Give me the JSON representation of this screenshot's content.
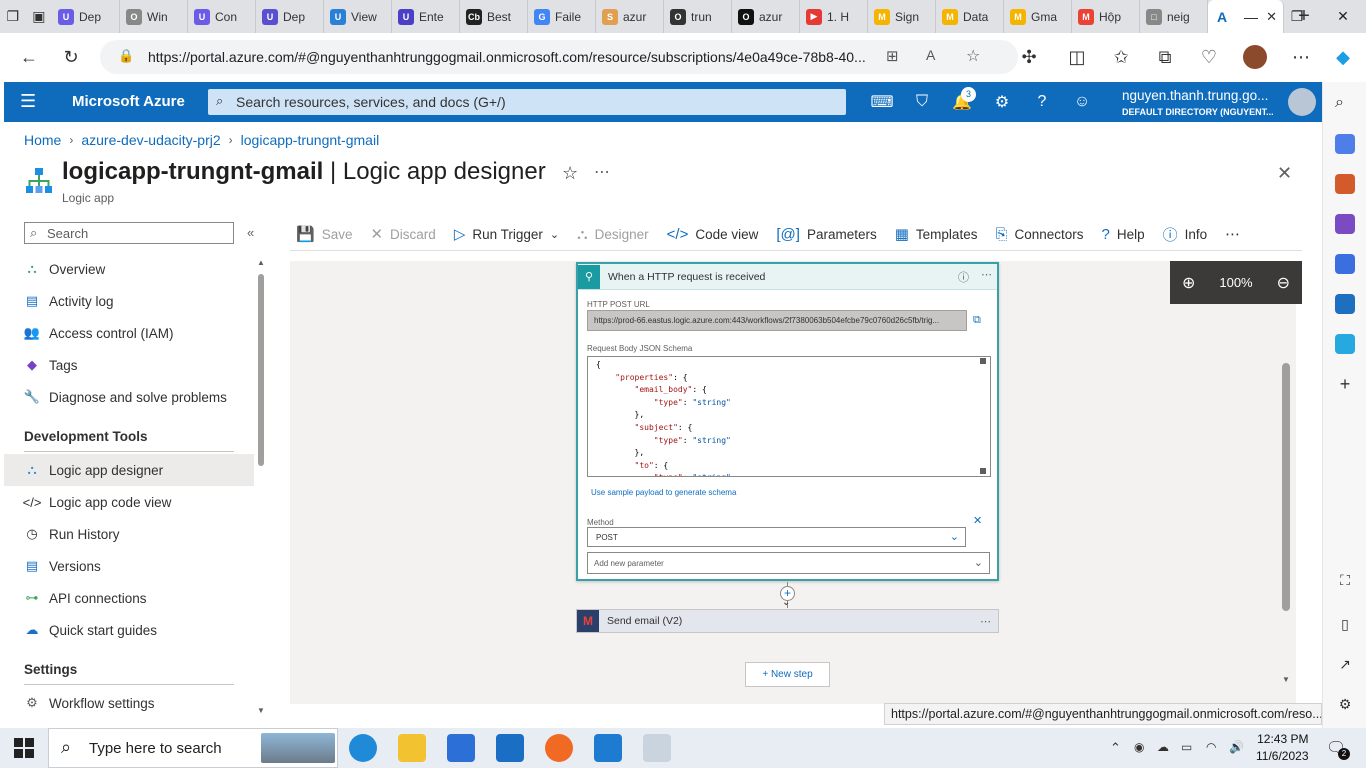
{
  "browser": {
    "tabs": [
      {
        "label": "Dep",
        "color": "#6b5ce7",
        "glyph": "U"
      },
      {
        "label": "Win",
        "color": "#888888",
        "glyph": "O"
      },
      {
        "label": "Con",
        "color": "#6b5ce7",
        "glyph": "U"
      },
      {
        "label": "Dep",
        "color": "#5b4fd1",
        "glyph": "U"
      },
      {
        "label": "View",
        "color": "#2a7fd6",
        "glyph": "U"
      },
      {
        "label": "Ente",
        "color": "#4b3fc7",
        "glyph": "U"
      },
      {
        "label": "Best",
        "color": "#222222",
        "glyph": "Cb"
      },
      {
        "label": "Faile",
        "color": "#4285f4",
        "glyph": "G"
      },
      {
        "label": "azur",
        "color": "#e0a050",
        "glyph": "S"
      },
      {
        "label": "trun",
        "color": "#333333",
        "glyph": "O"
      },
      {
        "label": "azur",
        "color": "#111111",
        "glyph": "O"
      },
      {
        "label": "1. H",
        "color": "#e53935",
        "glyph": "▶"
      },
      {
        "label": "Sign",
        "color": "#f4b400",
        "glyph": "M"
      },
      {
        "label": "Data",
        "color": "#f4b400",
        "glyph": "M"
      },
      {
        "label": "Gma",
        "color": "#f4b400",
        "glyph": "M"
      },
      {
        "label": "Hộp",
        "color": "#ea4335",
        "glyph": "M"
      },
      {
        "label": "neig",
        "color": "#888888",
        "glyph": "□"
      }
    ],
    "active_tab_close": "✕",
    "new_tab": "+",
    "url": "https://portal.azure.com/#@nguyenthanhtrunggogmail.onmicrosoft.com/resource/subscriptions/4e0a49ce-78b8-40..."
  },
  "azure": {
    "brand": "Microsoft Azure",
    "search_placeholder": "Search resources, services, and docs (G+/)",
    "notifications_count": "3",
    "user_name": "nguyen.thanh.trung.go...",
    "user_directory": "DEFAULT DIRECTORY (NGUYENT..."
  },
  "breadcrumb": [
    "Home",
    "azure-dev-udacity-prj2",
    "logicapp-trungnt-gmail"
  ],
  "page": {
    "title_bold": "logicapp-trungnt-gmail",
    "title_rest": " | Logic app designer",
    "subtitle": "Logic app"
  },
  "nav": {
    "search_placeholder": "Search",
    "items_top": [
      "Overview",
      "Activity log",
      "Access control (IAM)",
      "Tags",
      "Diagnose and solve problems"
    ],
    "section_dev": "Development Tools",
    "items_dev": [
      "Logic app designer",
      "Logic app code view",
      "Run History",
      "Versions",
      "API connections",
      "Quick start guides"
    ],
    "section_settings": "Settings",
    "items_settings": [
      "Workflow settings"
    ]
  },
  "toolbar": {
    "save": "Save",
    "discard": "Discard",
    "run_trigger": "Run Trigger",
    "designer": "Designer",
    "code_view": "Code view",
    "parameters": "Parameters",
    "templates": "Templates",
    "connectors": "Connectors",
    "help": "Help",
    "info": "Info"
  },
  "zoom": {
    "level": "100%"
  },
  "trigger": {
    "title": "When a HTTP request is received",
    "url_label": "HTTP POST URL",
    "url_value": "https://prod-66.eastus.logic.azure.com:443/workflows/2f7380063b504efcbe79c0760d26c5fb/trig...",
    "schema_label": "Request Body JSON Schema",
    "schema_lines": [
      "{",
      "    \"properties\": {",
      "        \"email_body\": {",
      "            \"type\": \"string\"",
      "        },",
      "        \"subject\": {",
      "            \"type\": \"string\"",
      "        },",
      "        \"to\": {",
      "            \"type\": \"string\""
    ],
    "sample_link": "Use sample payload to generate schema",
    "method_label": "Method",
    "method_value": "POST",
    "add_param": "Add new parameter"
  },
  "send_email": {
    "title": "Send email (V2)"
  },
  "new_step": "+ New step",
  "status_url": "https://portal.azure.com/#@nguyenthanhtrunggogmail.onmicrosoft.com/reso...",
  "taskbar": {
    "search_placeholder": "Type here to search",
    "time": "12:43 PM",
    "date": "11/6/2023",
    "notif_count": "2"
  }
}
